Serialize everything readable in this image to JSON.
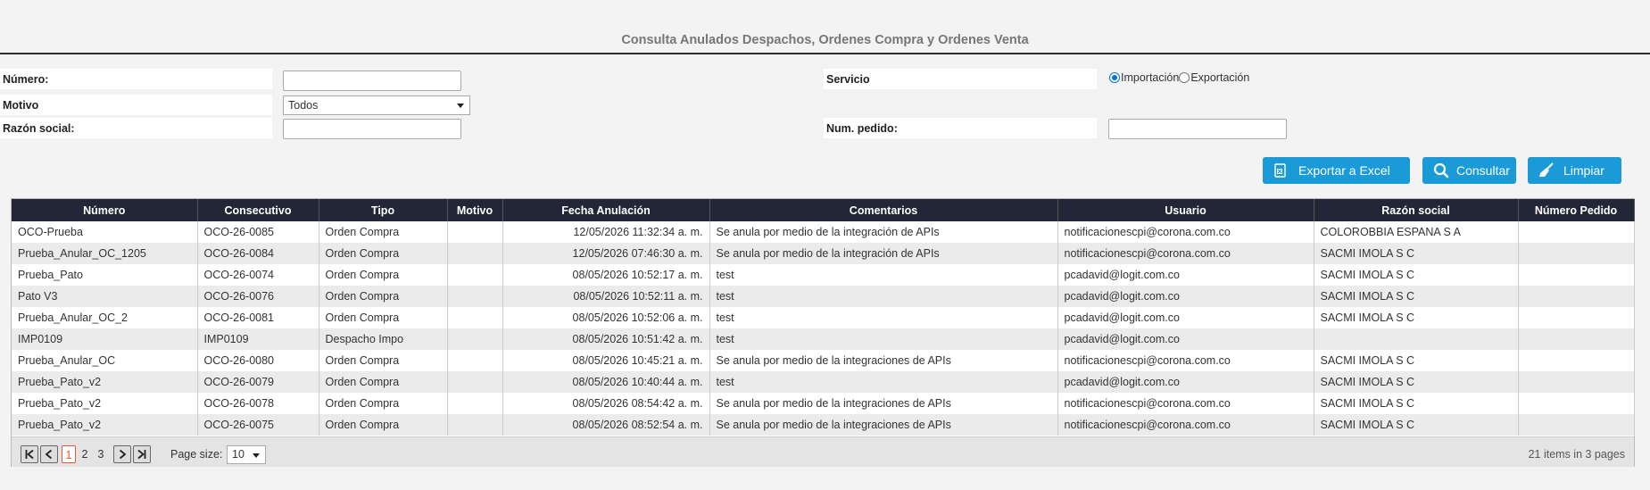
{
  "page_title": "Consulta Anulados Despachos, Ordenes Compra y Ordenes Venta",
  "form": {
    "numero_label": "Número:",
    "numero_value": "",
    "motivo_label": "Motivo",
    "motivo_value": "Todos",
    "razon_label": "Razón social:",
    "razon_value": "",
    "servicio_label": "Servicio",
    "importacion_label": "Importación",
    "exportacion_label": "Exportación",
    "servicio_selected": "Importación",
    "pedido_label": "Num. pedido:",
    "pedido_value": ""
  },
  "buttons": {
    "excel": "Exportar a Excel",
    "consultar": "Consultar",
    "limpiar": "Limpiar"
  },
  "table": {
    "columns": [
      "Número",
      "Consecutivo",
      "Tipo",
      "Motivo",
      "Fecha Anulación",
      "Comentarios",
      "Usuario",
      "Razón social",
      "Número Pedido"
    ],
    "rows": [
      [
        "OCO-Prueba",
        "OCO-26-0085",
        "Orden Compra",
        "",
        "12/05/2026 11:32:34 a. m.",
        "Se anula por medio de la integración de APIs",
        "notificacionescpi@corona.com.co",
        "COLOROBBIA ESPANA S A",
        ""
      ],
      [
        "Prueba_Anular_OC_1205",
        "OCO-26-0084",
        "Orden Compra",
        "",
        "12/05/2026 07:46:30 a. m.",
        "Se anula por medio de la integración de APIs",
        "notificacionescpi@corona.com.co",
        "SACMI IMOLA S C",
        ""
      ],
      [
        "Prueba_Pato",
        "OCO-26-0074",
        "Orden Compra",
        "",
        "08/05/2026 10:52:17 a. m.",
        "test",
        "pcadavid@logit.com.co",
        "SACMI IMOLA S C",
        ""
      ],
      [
        "Pato V3",
        "OCO-26-0076",
        "Orden Compra",
        "",
        "08/05/2026 10:52:11 a. m.",
        "test",
        "pcadavid@logit.com.co",
        "SACMI IMOLA S C",
        ""
      ],
      [
        "Prueba_Anular_OC_2",
        "OCO-26-0081",
        "Orden Compra",
        "",
        "08/05/2026 10:52:06 a. m.",
        "test",
        "pcadavid@logit.com.co",
        "SACMI IMOLA S C",
        ""
      ],
      [
        "IMP0109",
        "IMP0109",
        "Despacho Impo",
        "",
        "08/05/2026 10:51:42 a. m.",
        "test",
        "pcadavid@logit.com.co",
        "",
        ""
      ],
      [
        "Prueba_Anular_OC",
        "OCO-26-0080",
        "Orden Compra",
        "",
        "08/05/2026 10:45:21 a. m.",
        "Se anula por medio de la integraciones de APIs",
        "notificacionescpi@corona.com.co",
        "SACMI IMOLA S C",
        ""
      ],
      [
        "Prueba_Pato_v2",
        "OCO-26-0079",
        "Orden Compra",
        "",
        "08/05/2026 10:40:44 a. m.",
        "test",
        "pcadavid@logit.com.co",
        "SACMI IMOLA S C",
        ""
      ],
      [
        "Prueba_Pato_v2",
        "OCO-26-0078",
        "Orden Compra",
        "",
        "08/05/2026 08:54:42 a. m.",
        "Se anula por medio de la integraciones de APIs",
        "notificacionescpi@corona.com.co",
        "SACMI IMOLA S C",
        ""
      ],
      [
        "Prueba_Pato_v2",
        "OCO-26-0075",
        "Orden Compra",
        "",
        "08/05/2026 08:52:54 a. m.",
        "Se anula por medio de la integraciones de APIs",
        "notificacionescpi@corona.com.co",
        "SACMI IMOLA S C",
        ""
      ]
    ]
  },
  "pager": {
    "pages": [
      "1",
      "2",
      "3"
    ],
    "current_page": "1",
    "page_size_label": "Page size:",
    "page_size": "10",
    "info": "21 items in 3 pages"
  },
  "colors": {
    "accent": "#1a9ad6",
    "header_bg": "#222636",
    "active_page": "#e0583a"
  },
  "icons": {
    "excel": "excel-icon",
    "consultar": "search-icon",
    "limpiar": "broom-icon",
    "first": "first-page-icon",
    "prev": "prev-page-icon",
    "next": "next-page-icon",
    "last": "last-page-icon"
  }
}
